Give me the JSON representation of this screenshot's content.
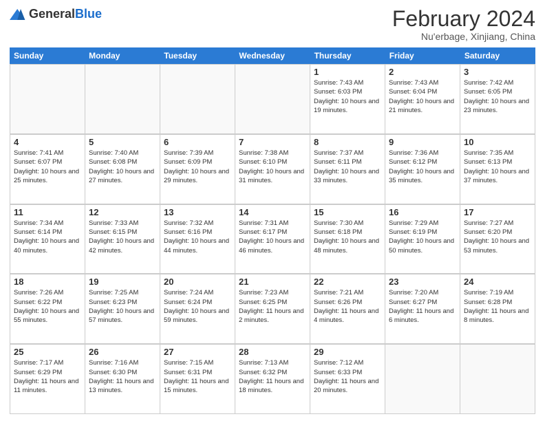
{
  "header": {
    "logo_general": "General",
    "logo_blue": "Blue",
    "title": "February 2024",
    "location": "Nu'erbage, Xinjiang, China"
  },
  "days_of_week": [
    "Sunday",
    "Monday",
    "Tuesday",
    "Wednesday",
    "Thursday",
    "Friday",
    "Saturday"
  ],
  "weeks": [
    [
      {
        "day": "",
        "info": ""
      },
      {
        "day": "",
        "info": ""
      },
      {
        "day": "",
        "info": ""
      },
      {
        "day": "",
        "info": ""
      },
      {
        "day": "1",
        "info": "Sunrise: 7:43 AM\nSunset: 6:03 PM\nDaylight: 10 hours and 19 minutes."
      },
      {
        "day": "2",
        "info": "Sunrise: 7:43 AM\nSunset: 6:04 PM\nDaylight: 10 hours and 21 minutes."
      },
      {
        "day": "3",
        "info": "Sunrise: 7:42 AM\nSunset: 6:05 PM\nDaylight: 10 hours and 23 minutes."
      }
    ],
    [
      {
        "day": "4",
        "info": "Sunrise: 7:41 AM\nSunset: 6:07 PM\nDaylight: 10 hours and 25 minutes."
      },
      {
        "day": "5",
        "info": "Sunrise: 7:40 AM\nSunset: 6:08 PM\nDaylight: 10 hours and 27 minutes."
      },
      {
        "day": "6",
        "info": "Sunrise: 7:39 AM\nSunset: 6:09 PM\nDaylight: 10 hours and 29 minutes."
      },
      {
        "day": "7",
        "info": "Sunrise: 7:38 AM\nSunset: 6:10 PM\nDaylight: 10 hours and 31 minutes."
      },
      {
        "day": "8",
        "info": "Sunrise: 7:37 AM\nSunset: 6:11 PM\nDaylight: 10 hours and 33 minutes."
      },
      {
        "day": "9",
        "info": "Sunrise: 7:36 AM\nSunset: 6:12 PM\nDaylight: 10 hours and 35 minutes."
      },
      {
        "day": "10",
        "info": "Sunrise: 7:35 AM\nSunset: 6:13 PM\nDaylight: 10 hours and 37 minutes."
      }
    ],
    [
      {
        "day": "11",
        "info": "Sunrise: 7:34 AM\nSunset: 6:14 PM\nDaylight: 10 hours and 40 minutes."
      },
      {
        "day": "12",
        "info": "Sunrise: 7:33 AM\nSunset: 6:15 PM\nDaylight: 10 hours and 42 minutes."
      },
      {
        "day": "13",
        "info": "Sunrise: 7:32 AM\nSunset: 6:16 PM\nDaylight: 10 hours and 44 minutes."
      },
      {
        "day": "14",
        "info": "Sunrise: 7:31 AM\nSunset: 6:17 PM\nDaylight: 10 hours and 46 minutes."
      },
      {
        "day": "15",
        "info": "Sunrise: 7:30 AM\nSunset: 6:18 PM\nDaylight: 10 hours and 48 minutes."
      },
      {
        "day": "16",
        "info": "Sunrise: 7:29 AM\nSunset: 6:19 PM\nDaylight: 10 hours and 50 minutes."
      },
      {
        "day": "17",
        "info": "Sunrise: 7:27 AM\nSunset: 6:20 PM\nDaylight: 10 hours and 53 minutes."
      }
    ],
    [
      {
        "day": "18",
        "info": "Sunrise: 7:26 AM\nSunset: 6:22 PM\nDaylight: 10 hours and 55 minutes."
      },
      {
        "day": "19",
        "info": "Sunrise: 7:25 AM\nSunset: 6:23 PM\nDaylight: 10 hours and 57 minutes."
      },
      {
        "day": "20",
        "info": "Sunrise: 7:24 AM\nSunset: 6:24 PM\nDaylight: 10 hours and 59 minutes."
      },
      {
        "day": "21",
        "info": "Sunrise: 7:23 AM\nSunset: 6:25 PM\nDaylight: 11 hours and 2 minutes."
      },
      {
        "day": "22",
        "info": "Sunrise: 7:21 AM\nSunset: 6:26 PM\nDaylight: 11 hours and 4 minutes."
      },
      {
        "day": "23",
        "info": "Sunrise: 7:20 AM\nSunset: 6:27 PM\nDaylight: 11 hours and 6 minutes."
      },
      {
        "day": "24",
        "info": "Sunrise: 7:19 AM\nSunset: 6:28 PM\nDaylight: 11 hours and 8 minutes."
      }
    ],
    [
      {
        "day": "25",
        "info": "Sunrise: 7:17 AM\nSunset: 6:29 PM\nDaylight: 11 hours and 11 minutes."
      },
      {
        "day": "26",
        "info": "Sunrise: 7:16 AM\nSunset: 6:30 PM\nDaylight: 11 hours and 13 minutes."
      },
      {
        "day": "27",
        "info": "Sunrise: 7:15 AM\nSunset: 6:31 PM\nDaylight: 11 hours and 15 minutes."
      },
      {
        "day": "28",
        "info": "Sunrise: 7:13 AM\nSunset: 6:32 PM\nDaylight: 11 hours and 18 minutes."
      },
      {
        "day": "29",
        "info": "Sunrise: 7:12 AM\nSunset: 6:33 PM\nDaylight: 11 hours and 20 minutes."
      },
      {
        "day": "",
        "info": ""
      },
      {
        "day": "",
        "info": ""
      }
    ]
  ]
}
